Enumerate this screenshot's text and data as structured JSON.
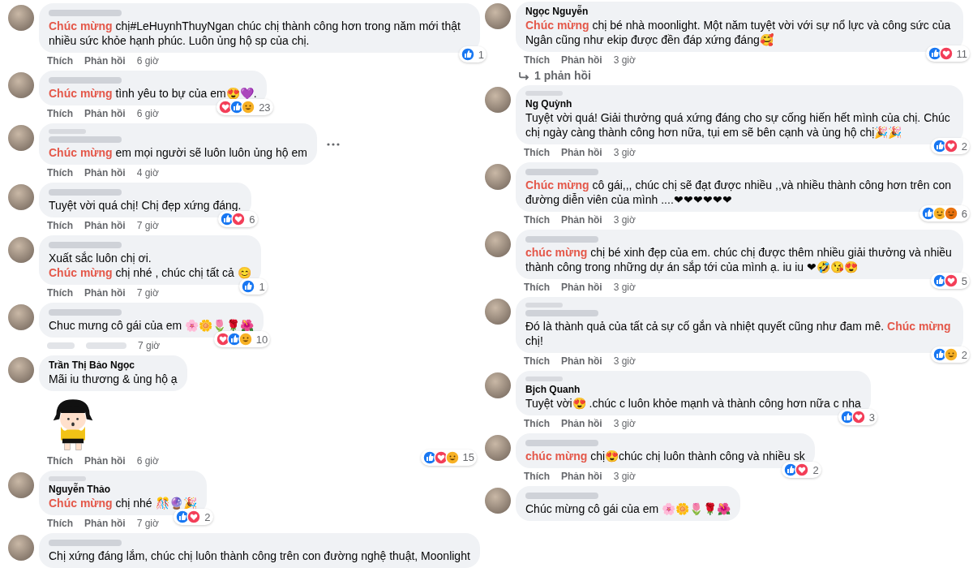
{
  "columns": [
    {
      "comments": [
        {
          "fan_badge": false,
          "lines": [
            [
              {
                "text": "Chúc mừng",
                "highlight": true
              },
              {
                "text": " chị#LeHuynhThuyNgan chúc chị thành công hơn trong năm mới thật nhiều sức khỏe hạnh phúc. Luôn ủng hộ sp của chị.",
                "highlight": false
              }
            ]
          ],
          "reactions": {
            "icons": [
              {
                "kind": "like"
              }
            ],
            "count": "1"
          },
          "actions": {
            "like": "Thích",
            "reply": "Phản hồi",
            "time": "6 giờ",
            "blurred": false
          }
        },
        {
          "fan_badge": false,
          "lines": [
            [
              {
                "text": "Chúc mừng",
                "highlight": true
              },
              {
                "text": " tình yêu to bự của em😍💜.",
                "highlight": false
              }
            ]
          ],
          "reactions": {
            "icons": [
              {
                "kind": "love"
              },
              {
                "kind": "like"
              },
              {
                "kind": "haha"
              }
            ],
            "count": "23"
          },
          "actions": {
            "like": "Thích",
            "reply": "Phản hồi",
            "time": "6 giờ",
            "blurred": false
          }
        },
        {
          "fan_badge": true,
          "more_button": true,
          "lines": [
            [
              {
                "text": "Chúc mừng",
                "highlight": true
              },
              {
                "text": " em mọi người sẽ luôn luôn ủng hộ em",
                "highlight": false
              }
            ]
          ],
          "actions": {
            "like": "Thích",
            "reply": "Phản hồi",
            "time": "4 giờ",
            "blurred": false
          }
        },
        {
          "fan_badge": false,
          "lines": [
            [
              {
                "text": "Tuyệt vời quá chị! Chị đẹp xứng đáng.",
                "highlight": false
              }
            ]
          ],
          "reactions": {
            "icons": [
              {
                "kind": "like"
              },
              {
                "kind": "love"
              }
            ],
            "count": "6"
          },
          "actions": {
            "like": "Thích",
            "reply": "Phản hồi",
            "time": "7 giờ",
            "blurred": false
          }
        },
        {
          "fan_badge": false,
          "lines": [
            [
              {
                "text": "Xuất sắc luôn chị ơi.",
                "highlight": false
              }
            ],
            [
              {
                "text": "Chúc mừng",
                "highlight": true
              },
              {
                "text": " chị nhé , chúc chị tất cả 😊",
                "highlight": false
              }
            ]
          ],
          "reactions": {
            "icons": [
              {
                "kind": "like"
              }
            ],
            "count": "1"
          },
          "actions": {
            "like": "Thích",
            "reply": "Phản hồi",
            "time": "7 giờ",
            "blurred": false
          }
        },
        {
          "fan_badge": false,
          "lines": [
            [
              {
                "text": "Chuc mưng cô gái của em 🌸🌼🌷🌹🌺",
                "highlight": false
              }
            ]
          ],
          "reactions": {
            "icons": [
              {
                "kind": "love"
              },
              {
                "kind": "like"
              },
              {
                "kind": "haha"
              }
            ],
            "count": "10"
          },
          "actions": {
            "time": "7 giờ",
            "blurred": true
          }
        },
        {
          "fan_badge": false,
          "name": "Trần Thị Bảo Ngọc",
          "sticker": true,
          "lines": [
            [
              {
                "text": "Mãi iu thương & ủng hộ ạ",
                "highlight": false
              }
            ]
          ],
          "reactions": {
            "icons": [
              {
                "kind": "like"
              },
              {
                "kind": "love"
              },
              {
                "kind": "haha"
              }
            ],
            "count": "15"
          },
          "actions": {
            "like": "Thích",
            "reply": "Phản hồi",
            "time": "6 giờ",
            "blurred": false
          }
        },
        {
          "fan_badge": true,
          "name": "Nguyễn Thảo",
          "lines": [
            [
              {
                "text": "Chúc mừng",
                "highlight": true
              },
              {
                "text": " chị nhé 🎊🔮🎉",
                "highlight": false
              }
            ]
          ],
          "reactions": {
            "icons": [
              {
                "kind": "like"
              },
              {
                "kind": "love"
              }
            ],
            "count": "2"
          },
          "actions": {
            "like": "Thích",
            "reply": "Phản hồi",
            "time": "7 giờ",
            "blurred": false
          }
        },
        {
          "fan_badge": false,
          "lines": [
            [
              {
                "text": "Chị xứng đáng lắm, chúc chị luôn thành công trên con đường nghệ thuật, Moonlight",
                "highlight": false
              }
            ]
          ]
        }
      ]
    },
    {
      "comments": [
        {
          "fan_badge": false,
          "name": "Ngọc Nguyễn",
          "lines": [
            [
              {
                "text": "Chúc mừng",
                "highlight": true
              },
              {
                "text": " chị bé nhà moonlight. Một năm tuyệt vời với sự nổ lực và công sức của Ngân cũng như ekip được đền đáp xứng đáng🥰",
                "highlight": false
              }
            ]
          ],
          "reactions": {
            "icons": [
              {
                "kind": "like"
              },
              {
                "kind": "love"
              }
            ],
            "count": "11"
          },
          "actions": {
            "like": "Thích",
            "reply": "Phản hồi",
            "time": "3 giờ",
            "blurred": false
          },
          "replies_link": "1 phản hồi"
        },
        {
          "fan_badge": true,
          "name": "Ng Quỳnh",
          "lines": [
            [
              {
                "text": "Tuyệt vời quá! Giải thưởng quá xứng đáng cho sự cống hiến hết mình của chị. Chúc chị ngày càng thành công hơn nữa, tụi em sẽ bên cạnh và ủng hộ chị🎉🎉",
                "highlight": false
              }
            ]
          ],
          "reactions": {
            "icons": [
              {
                "kind": "like"
              },
              {
                "kind": "love"
              }
            ],
            "count": "2"
          },
          "actions": {
            "like": "Thích",
            "reply": "Phản hồi",
            "time": "3 giờ",
            "blurred": false
          }
        },
        {
          "fan_badge": false,
          "lines": [
            [
              {
                "text": "Chúc mừng",
                "highlight": true
              },
              {
                "text": " cô gái,,, chúc chị sẽ đạt được nhiều ,,và nhiều thành công hơn trên con đường diễn viên của mình ....❤❤❤❤❤❤",
                "highlight": false
              }
            ]
          ],
          "reactions": {
            "icons": [
              {
                "kind": "like"
              },
              {
                "kind": "care"
              },
              {
                "kind": "angry"
              }
            ],
            "count": "6"
          },
          "actions": {
            "like": "Thích",
            "reply": "Phản hồi",
            "time": "3 giờ",
            "blurred": false
          }
        },
        {
          "fan_badge": false,
          "lines": [
            [
              {
                "text": "chúc mừng",
                "highlight": true
              },
              {
                "text": " chị bé xinh đẹp của em. chúc chị được thêm nhiều giải thưởng và nhiều thành công trong những dự án sắp tới của mình ạ. iu iu ❤🤣😘😍",
                "highlight": false
              }
            ]
          ],
          "reactions": {
            "icons": [
              {
                "kind": "like"
              },
              {
                "kind": "love"
              }
            ],
            "count": "5"
          },
          "actions": {
            "like": "Thích",
            "reply": "Phản hồi",
            "time": "3 giờ",
            "blurred": false
          }
        },
        {
          "fan_badge": true,
          "lines": [
            [
              {
                "text": "Đó là thành quả của tất cả sự cố gắn và nhiệt quyết cũng như đam mê. ",
                "highlight": false
              },
              {
                "text": "Chúc mừng",
                "highlight": true
              },
              {
                "text": " chị!",
                "highlight": false
              }
            ]
          ],
          "reactions": {
            "icons": [
              {
                "kind": "like"
              },
              {
                "kind": "care"
              }
            ],
            "count": "2"
          },
          "actions": {
            "like": "Thích",
            "reply": "Phản hồi",
            "time": "3 giờ",
            "blurred": false
          }
        },
        {
          "fan_badge": true,
          "name": "Bjch Quanh",
          "lines": [
            [
              {
                "text": "Tuyệt vời😍 .chúc c luôn khỏe mạnh và thành công hơn nữa c nha",
                "highlight": false
              }
            ]
          ],
          "reactions": {
            "icons": [
              {
                "kind": "like"
              },
              {
                "kind": "love"
              }
            ],
            "count": "3"
          },
          "actions": {
            "like": "Thích",
            "reply": "Phản hồi",
            "time": "3 giờ",
            "blurred": false
          }
        },
        {
          "fan_badge": false,
          "lines": [
            [
              {
                "text": "chúc mừng",
                "highlight": true
              },
              {
                "text": " chị😍chúc chị luôn thành công và nhiều sk",
                "highlight": false
              }
            ]
          ],
          "reactions": {
            "icons": [
              {
                "kind": "like"
              },
              {
                "kind": "love"
              }
            ],
            "count": "2"
          },
          "actions": {
            "like": "Thích",
            "reply": "Phản hồi",
            "time": "3 giờ",
            "blurred": false
          }
        },
        {
          "fan_badge": false,
          "lines": [
            [
              {
                "text": "Chúc mừng cô gái của em 🌸🌼🌷🌹🌺",
                "highlight": false
              }
            ]
          ]
        }
      ]
    }
  ]
}
